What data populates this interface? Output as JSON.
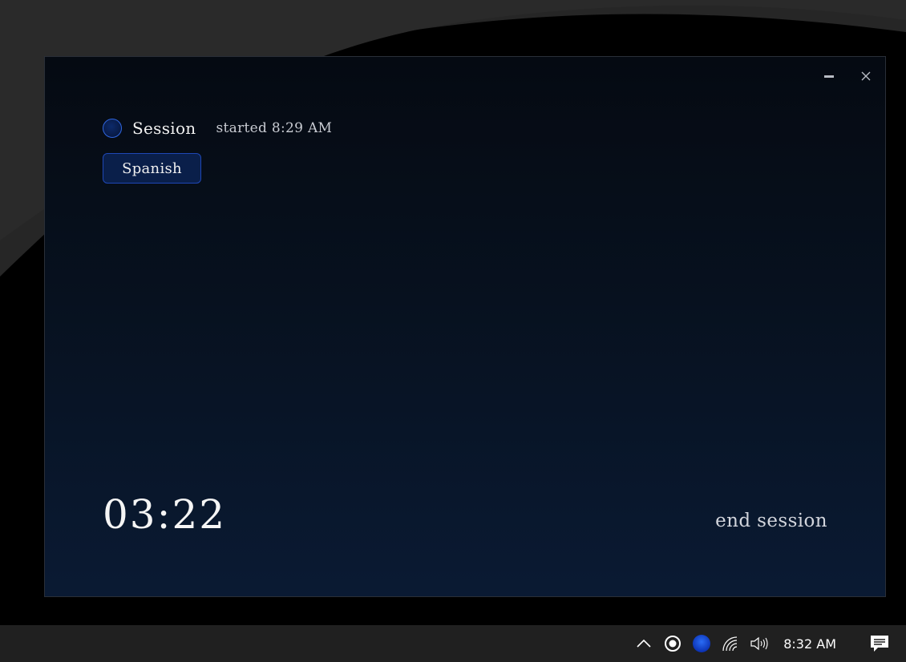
{
  "window": {
    "minimize_icon": "minimize-icon",
    "close_icon": "close-icon"
  },
  "session": {
    "title": "Session",
    "started": "started 8:29 AM",
    "language": "Spanish",
    "timer": "03:22",
    "end_label": "end session",
    "accent": "#2f66e0"
  },
  "taskbar": {
    "tray_icons": [
      "chevron-up-icon",
      "record-icon",
      "app-dot-icon",
      "wifi-icon",
      "volume-icon"
    ],
    "clock": "8:32 AM",
    "notification_icon": "action-center-icon"
  }
}
